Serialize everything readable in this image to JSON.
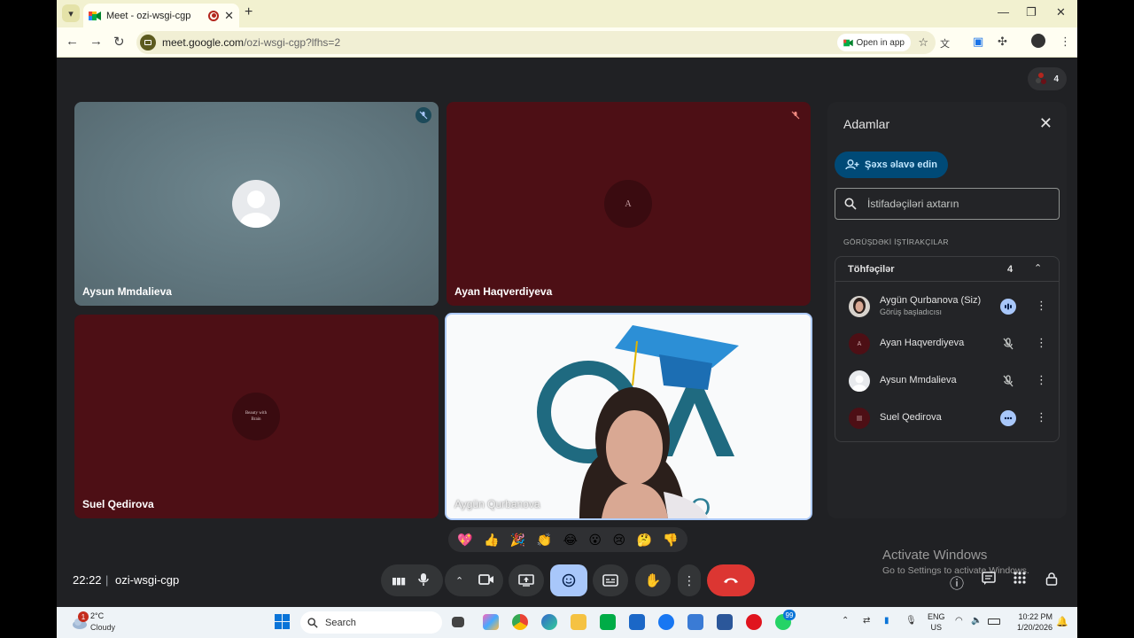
{
  "browser": {
    "tab_title": "Meet - ozi-wsgi-cgp",
    "url_host": "meet.google.com",
    "url_path": "/ozi-wsgi-cgp?lfhs=2",
    "open_in_app": "Open in app"
  },
  "meet": {
    "participant_chip_count": "4",
    "time": "22:22",
    "separator": "|",
    "meeting_code": "ozi-wsgi-cgp",
    "tiles": [
      {
        "name": "Aysun Mmdalieva"
      },
      {
        "name": "Ayan Haqverdiyeva",
        "avatar_letter": "A"
      },
      {
        "name": "Suel Qedirova",
        "avatar_text": "Beauty with Brain"
      },
      {
        "name": "Aygün Qurbanova"
      }
    ],
    "reactions": [
      "💖",
      "👍",
      "🎉",
      "👏",
      "😂",
      "😮",
      "😢",
      "🤔",
      "👎"
    ],
    "watermark": {
      "line1": "Activate Windows",
      "line2": "Go to Settings to activate Windows."
    }
  },
  "people_panel": {
    "title": "Adamlar",
    "add_button": "Şəxs əlavə edin",
    "search_placeholder": "İstifadəçiləri axtarın",
    "section_label": "GÖRÜŞDƏKİ İŞTİRAKÇILAR",
    "group_label": "Töhfəçilər",
    "group_count": "4",
    "participants": [
      {
        "name": "Aygün Qurbanova (Siz)",
        "subtitle": "Görüş başladıcısı",
        "status": "speaking"
      },
      {
        "name": "Ayan Haqverdiyeva",
        "status": "muted"
      },
      {
        "name": "Aysun Mmdalieva",
        "status": "muted"
      },
      {
        "name": "Suel Qedirova",
        "status": "more"
      }
    ]
  },
  "taskbar": {
    "temperature": "2°C",
    "condition": "Cloudy",
    "weather_badge": "1",
    "search_label": "Search",
    "whatsapp_badge": "99",
    "lang_line1": "ENG",
    "lang_line2": "US",
    "clock_time": "10:22 PM",
    "clock_date": "1/20/2026"
  }
}
